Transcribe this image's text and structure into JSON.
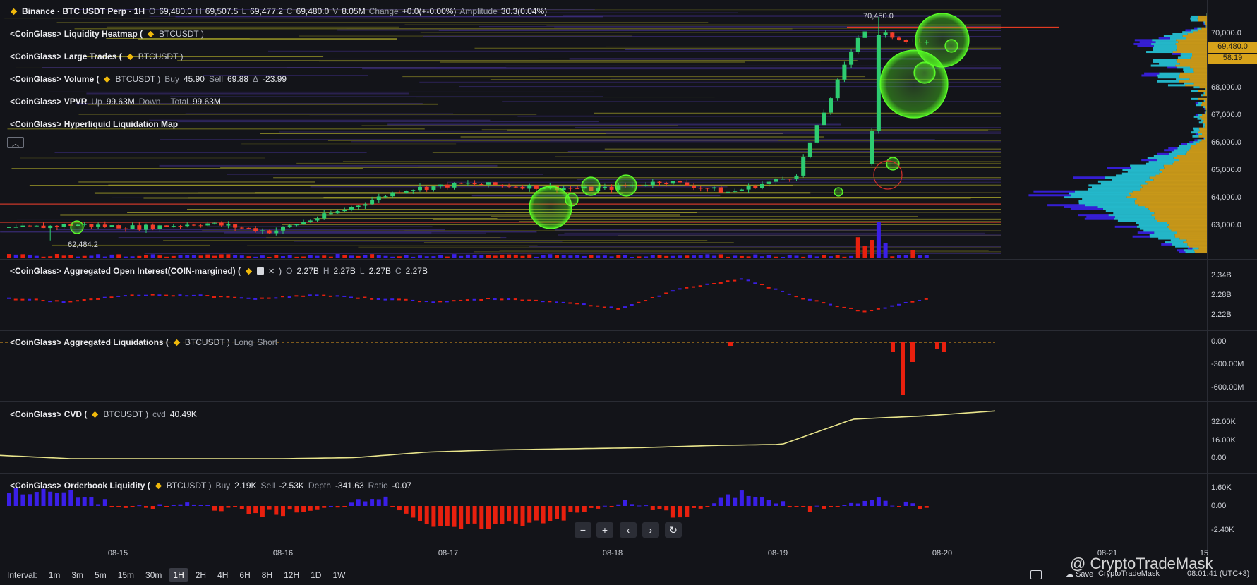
{
  "header": {
    "symbol_line": "Binance · BTC USDT Perp · 1H",
    "ohlc": [
      {
        "k": "O",
        "v": "69,480.0"
      },
      {
        "k": "H",
        "v": "69,507.5"
      },
      {
        "k": "L",
        "v": "69,477.2"
      },
      {
        "k": "C",
        "v": "69,480.0"
      },
      {
        "k": "V",
        "v": "8.05M"
      },
      {
        "k": "Change",
        "v": "+0.0(+-0.00%)"
      },
      {
        "k": "Amplitude",
        "v": "30.3(0.04%)"
      }
    ]
  },
  "indicators": {
    "heatmap": {
      "title": "<CoinGlass> Liquidity Heatmap (",
      "sym": "BTCUSDT )"
    },
    "large_trades": {
      "title": "<CoinGlass> Large Trades (",
      "sym": "BTCUSDT )"
    },
    "volume": {
      "title": "<CoinGlass> Volume (",
      "sym": "BTCUSDT )",
      "buy_k": "Buy",
      "buy_v": "45.90",
      "sell_k": "Sell",
      "sell_v": "69.88",
      "delta_k": "Δ",
      "delta_v": "-23.99"
    },
    "vpvr": {
      "title": "<CoinGlass> VPVR",
      "up_k": "Up",
      "up_v": "99.63M",
      "down_k": "Down",
      "total_k": "Total",
      "total_v": "99.63M"
    },
    "hyper": {
      "title": "<CoinGlass> Hyperliquid Liquidation Map"
    },
    "oi": {
      "title": "<CoinGlass> Aggregated Open Interest(COIN-margined) (",
      "close": ")",
      "o_k": "O",
      "o_v": "2.27B",
      "h_k": "H",
      "h_v": "2.27B",
      "l_k": "L",
      "l_v": "2.27B",
      "c_k": "C",
      "c_v": "2.27B"
    },
    "liq": {
      "title": "<CoinGlass> Aggregated Liquidations (",
      "sym": "BTCUSDT )",
      "long": "Long",
      "short": "Short"
    },
    "cvd": {
      "title": "<CoinGlass> CVD (",
      "sym": "BTCUSDT )",
      "k": "cvd",
      "v": "40.49K"
    },
    "ob": {
      "title": "<CoinGlass> Orderbook Liquidity (",
      "sym": "BTCUSDT )",
      "buy_k": "Buy",
      "buy_v": "2.19K",
      "sell_k": "Sell",
      "sell_v": "-2.53K",
      "depth_k": "Depth",
      "depth_v": "-341.63",
      "ratio_k": "Ratio",
      "ratio_v": "-0.07"
    }
  },
  "price_axis": [
    "70,000.0",
    "69,480.0",
    "58:19",
    "68,000.0",
    "67,000.0",
    "66,000.0",
    "65,000.0",
    "64,000.0",
    "63,000.0"
  ],
  "oi_axis": [
    "2.34B",
    "2.28B",
    "2.22B"
  ],
  "liq_axis": [
    "0.00",
    "-300.00M",
    "-600.00M"
  ],
  "cvd_axis": [
    "32.00K",
    "16.00K",
    "0.00"
  ],
  "ob_axis": [
    "1.60K",
    "0.00",
    "-2.40K"
  ],
  "x_axis": [
    "08-15",
    "08-16",
    "08-17",
    "08-18",
    "08-19",
    "08-20",
    "08-21",
    "15"
  ],
  "annotations": {
    "high": "70,450.0",
    "low": "62,484.2"
  },
  "nav": {
    "zoom_out": "−",
    "zoom_in": "+",
    "prev": "‹",
    "next": "›",
    "reset": "↻"
  },
  "toolbar": {
    "interval_label": "Interval:",
    "intervals": [
      "1m",
      "3m",
      "5m",
      "15m",
      "30m",
      "1H",
      "2H",
      "4H",
      "6H",
      "8H",
      "12H",
      "1D",
      "1W"
    ],
    "active": "1H",
    "save": "Save",
    "account": "CryptoTradeMask",
    "time": "08:01:41 (UTC+3)"
  },
  "watermark": "@ CryptoTradeMask",
  "colors": {
    "bg": "#131419",
    "up": "#2ecc71",
    "down": "#f23c2a",
    "cvd": "#e9e58c",
    "buy": "#3a1fe8",
    "sell": "#e8200e",
    "gold": "#d8a31a",
    "cyan": "#26c6da"
  },
  "chart_data": [
    {
      "type": "candlestick",
      "title": "Binance · BTC USDT Perp · 1H",
      "ylim": [
        62000,
        70800
      ],
      "x": [
        "08-15",
        "08-16",
        "08-17",
        "08-18",
        "08-19",
        "08-20"
      ],
      "close_trend": [
        62900,
        63050,
        62950,
        63100,
        62800,
        63500,
        64300,
        64500,
        64400,
        64300,
        64600,
        64200,
        64800,
        70000,
        69480
      ],
      "high": 70450.0,
      "low": 62484.2
    },
    {
      "type": "line",
      "title": "<CoinGlass> Aggregated Open Interest(COIN-margined)",
      "ylim": [
        2.2,
        2.36
      ],
      "values": [
        2.27,
        2.26,
        2.28,
        2.28,
        2.27,
        2.28,
        2.27,
        2.26,
        2.27,
        2.26,
        2.24,
        2.3,
        2.33,
        2.27,
        2.23,
        2.27
      ]
    },
    {
      "type": "bar",
      "title": "<CoinGlass> Aggregated Liquidations",
      "ylim": [
        -700,
        50
      ],
      "values": [
        0,
        0,
        0,
        0,
        0,
        0,
        -10,
        -20,
        -600,
        -40,
        -80
      ]
    },
    {
      "type": "line",
      "title": "<CoinGlass> CVD",
      "ylim": [
        -5,
        42
      ],
      "values": [
        0,
        -3,
        -3,
        -3,
        -3,
        -2,
        3,
        5,
        6,
        7,
        9,
        10,
        33,
        36,
        40.49
      ]
    },
    {
      "type": "bar",
      "title": "<CoinGlass> Orderbook Liquidity",
      "ylim": [
        -2.6,
        1.8
      ],
      "values": [
        1.2,
        1.0,
        -0.3,
        0.2,
        -0.6,
        -0.5,
        0.9,
        -1.9,
        -1.5,
        -1.0,
        0.3,
        -0.8,
        1.1,
        -0.4,
        0.6,
        -0.2
      ]
    }
  ]
}
